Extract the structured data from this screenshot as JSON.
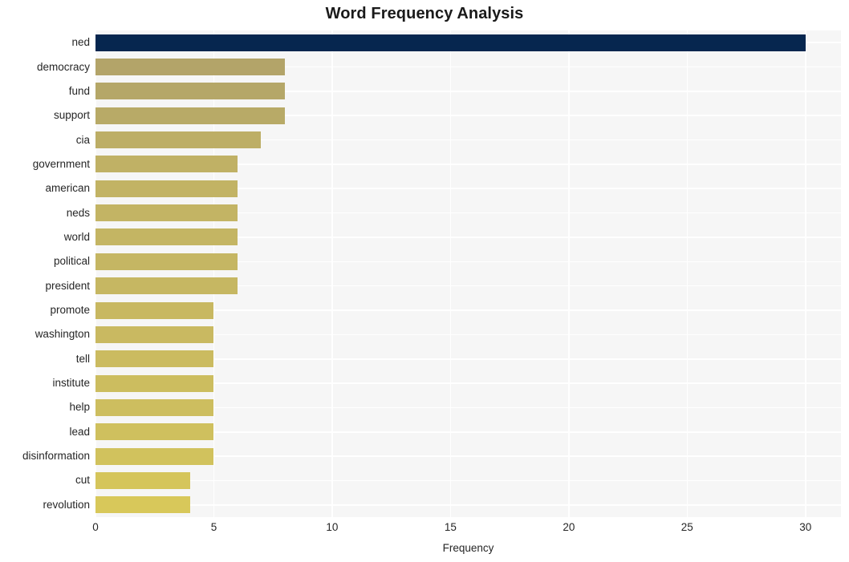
{
  "chart_data": {
    "type": "bar",
    "orientation": "horizontal",
    "title": "Word Frequency Analysis",
    "xlabel": "Frequency",
    "ylabel": "",
    "categories": [
      "ned",
      "democracy",
      "fund",
      "support",
      "cia",
      "government",
      "american",
      "neds",
      "world",
      "political",
      "president",
      "promote",
      "washington",
      "tell",
      "institute",
      "help",
      "lead",
      "disinformation",
      "cut",
      "revolution"
    ],
    "values": [
      30,
      8,
      8,
      8,
      7,
      6,
      6,
      6,
      6,
      6,
      6,
      5,
      5,
      5,
      5,
      5,
      5,
      5,
      4,
      4
    ],
    "xlim": [
      0,
      31.5
    ],
    "xticks": [
      0,
      5,
      10,
      15,
      20,
      25,
      30
    ],
    "xtick_labels": [
      "0",
      "5",
      "10",
      "15",
      "20",
      "25",
      "30"
    ],
    "grid": true,
    "grid_color": "#ffffff",
    "plot_background": "#f6f6f6",
    "figure_background": "#ffffff",
    "legend": null,
    "bar_colors": [
      "#06264f",
      "#b3a469",
      "#b5a768",
      "#b8aa67",
      "#bdae66",
      "#c0b165",
      "#c2b364",
      "#c3b464",
      "#c4b563",
      "#c5b663",
      "#c6b762",
      "#c8b861",
      "#c9b961",
      "#cbbb60",
      "#ccbd5f",
      "#cdbe5f",
      "#cfc05e",
      "#d1c25d",
      "#d5c55b",
      "#d8c85a"
    ]
  }
}
